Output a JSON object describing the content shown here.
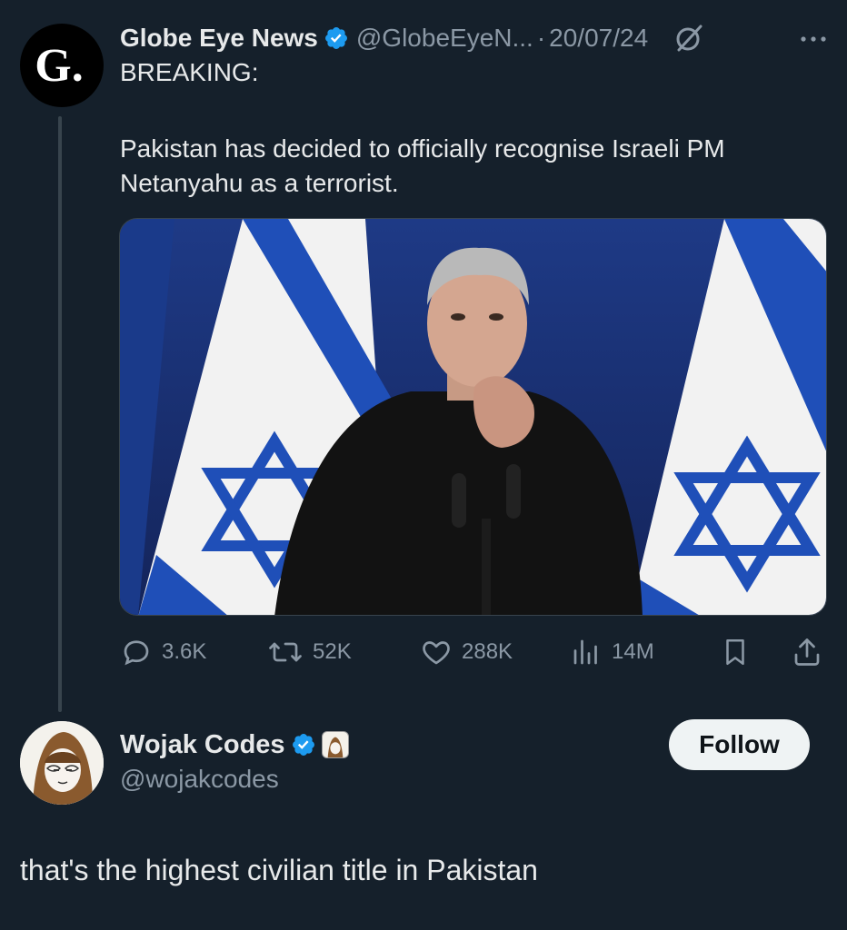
{
  "colors": {
    "background": "#15202b",
    "primary_text": "#e7e9ea",
    "secondary_text": "#8b98a5",
    "verified_blue": "#1d9bf0",
    "follow_button_bg": "#eff3f4"
  },
  "original_tweet": {
    "author_name": "Globe Eye News",
    "avatar_letter": "G.",
    "handle": "@GlobeEyeN...",
    "separator": "·",
    "date": "20/07/24",
    "verified_icon": "verified-badge-icon",
    "grok_icon": "grok-icon",
    "more_icon": "more-icon",
    "heading": "BREAKING:",
    "body": "Pakistan has decided to officially recognise Israeli PM Netanyahu as a terrorist.",
    "actions": {
      "replies": {
        "icon": "reply-icon",
        "count": "3.6K"
      },
      "reposts": {
        "icon": "repost-icon",
        "count": "52K"
      },
      "likes": {
        "icon": "heart-icon",
        "count": "288K"
      },
      "views": {
        "icon": "views-icon",
        "count": "14M"
      },
      "bookmark": {
        "icon": "bookmark-icon"
      },
      "share": {
        "icon": "share-icon"
      }
    }
  },
  "reply": {
    "author_name": "Wojak Codes",
    "handle": "@wojakcodes",
    "verified_icon": "verified-badge-icon",
    "affiliate_icon": "affiliate-badge-icon",
    "follow_label": "Follow",
    "text": "that's the highest civilian title in Pakistan"
  }
}
